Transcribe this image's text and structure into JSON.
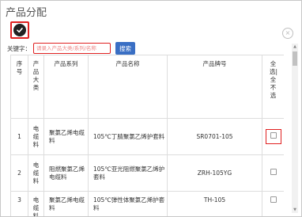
{
  "dialog": {
    "title": "产品分配",
    "close_glyph": "×"
  },
  "search": {
    "label": "关键字：",
    "placeholder": "请录入产品大类/系列/名称",
    "button_label": "搜索"
  },
  "table": {
    "headers": {
      "index": "序号",
      "category": "产品大类",
      "series": "产品系列",
      "name": "产品名称",
      "model": "产品牌号",
      "select_all": "全选|全不选"
    },
    "rows": [
      {
        "index": "1",
        "category": "电缆料",
        "series": "聚氯乙烯电缆料",
        "name": "105℃丁腈聚氯乙烯护套料",
        "model": "SR0701-105"
      },
      {
        "index": "2",
        "category": "电缆料",
        "series": "阻燃聚氯乙烯电缆料",
        "name": "105℃亚光阻燃聚氯乙烯护套料",
        "model": "ZRH-105YG"
      },
      {
        "index": "3",
        "category": "电缆料",
        "series": "聚氯乙烯电缆料",
        "name": "105℃弹性体聚氯乙烯护套料",
        "model": "TH-105"
      }
    ]
  },
  "colors": {
    "highlight": "#e02020",
    "button": "#3a6fc4"
  }
}
